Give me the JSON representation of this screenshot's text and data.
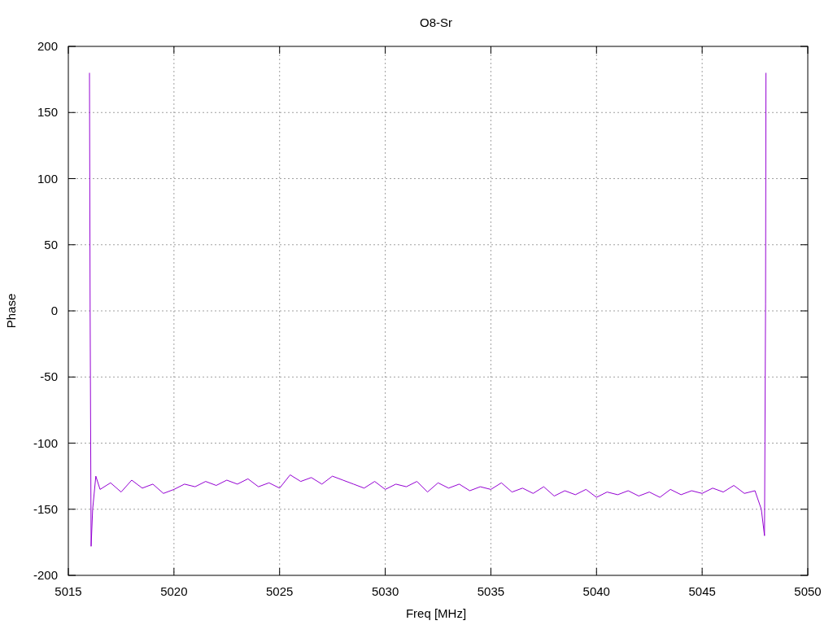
{
  "plot": {
    "chart_data": {
      "type": "line",
      "title": "O8-Sr",
      "xlabel": "Freq [MHz]",
      "ylabel": "Phase",
      "grid": true,
      "xlim": [
        5015,
        5050
      ],
      "ylim": [
        -200,
        200
      ],
      "xticks": [
        5015,
        5020,
        5025,
        5030,
        5035,
        5040,
        5045,
        5050
      ],
      "yticks": [
        -200,
        -150,
        -100,
        -50,
        0,
        50,
        100,
        150,
        200
      ],
      "x": [
        5016,
        5016.03,
        5016.08,
        5016.15,
        5016.3,
        5016.5,
        5017,
        5017.5,
        5018,
        5018.5,
        5019,
        5019.5,
        5020,
        5020.5,
        5021,
        5021.5,
        5022,
        5022.5,
        5023,
        5023.5,
        5024,
        5024.5,
        5025,
        5025.5,
        5026,
        5026.5,
        5027,
        5027.5,
        5028,
        5028.5,
        5029,
        5029.5,
        5030,
        5030.5,
        5031,
        5031.5,
        5032,
        5032.5,
        5033,
        5033.5,
        5034,
        5034.5,
        5035,
        5035.5,
        5036,
        5036.5,
        5037,
        5037.5,
        5038,
        5038.5,
        5039,
        5039.5,
        5040,
        5040.5,
        5041,
        5041.5,
        5042,
        5042.5,
        5043,
        5043.5,
        5044,
        5044.5,
        5045,
        5045.5,
        5046,
        5046.5,
        5047,
        5047.5,
        5047.8,
        5047.95,
        5048,
        5048.02
      ],
      "series": [
        {
          "color": "#9400d3",
          "values": [
            180,
            0,
            -178,
            -150,
            -125,
            -135,
            -130,
            -137,
            -128,
            -134,
            -131,
            -138,
            -135,
            -131,
            -133,
            -129,
            -132,
            -128,
            -131,
            -127,
            -133,
            -130,
            -134,
            -124,
            -129,
            -126,
            -131,
            -125,
            -128,
            -131,
            -134,
            -129,
            -135,
            -131,
            -133,
            -129,
            -137,
            -130,
            -134,
            -131,
            -136,
            -133,
            -135,
            -130,
            -137,
            -134,
            -138,
            -133,
            -140,
            -136,
            -139,
            -135,
            -141,
            -137,
            -139,
            -136,
            -140,
            -137,
            -141,
            -135,
            -139,
            -136,
            -138,
            -134,
            -137,
            -132,
            -138,
            -136,
            -150,
            -170,
            5,
            180
          ]
        }
      ]
    }
  }
}
